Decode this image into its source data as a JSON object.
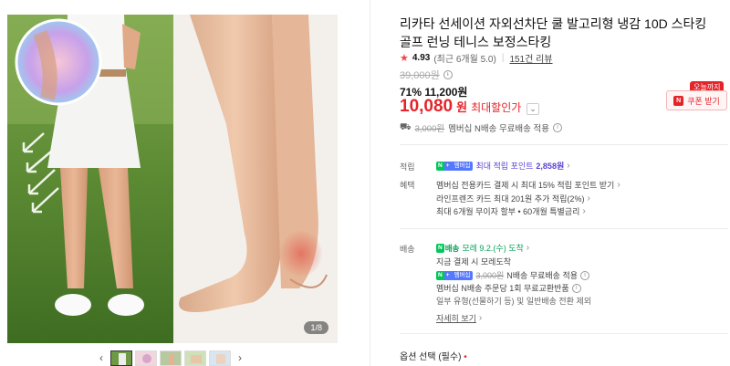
{
  "product": {
    "title": "리카타 선세이션 자외선차단 쿨 발고리형 냉감 10D 스타킹 골프 런닝 테니스 보정스타킹",
    "rating": "4.93",
    "rating_recent": "(최근 6개월 5.0)",
    "reviews": "151건 리뷰",
    "original_price": "39,000원",
    "discount_percent": "71%",
    "discount_price": "11,200원",
    "final_price": "10,080",
    "final_won": "원",
    "max_discount_label": "최대할인가",
    "image_counter": "1/8"
  },
  "coupon": {
    "badge": "오늘까지",
    "icon": "N",
    "label": "쿠폰 받기"
  },
  "shipping_summary": {
    "struck": "3,000원",
    "text": "멤버십 N배송 무료배송 적용"
  },
  "points": {
    "label": "적립",
    "npay_n": "N",
    "npay_plus": "+",
    "npay_member": "멤버십",
    "text_prefix": "최대 적립 포인트",
    "amount": "2,858원"
  },
  "benefits": {
    "label": "혜택",
    "lines": [
      "멤버십 전용카드 결제 시 최대 15% 적립 포인트 받기",
      "라인프렌즈 카드 최대 201원 추가 적립(2%)",
      "최대 6개월 무이자 할부 • 60개월 특별금리"
    ]
  },
  "delivery": {
    "label": "배송",
    "badge_n": "N",
    "badge_text": "배송",
    "eta": "모레 9.2.(수) 도착",
    "line2": "지금 결제 시 모레도착",
    "line3_struck": "3,000원",
    "line3_text": "N배송 무료배송 적용",
    "line4": "멤버십 N배송 주문당 1회 무료교환반품",
    "line5": "일부 유형(선물하기 등) 및 일반배송 전환 제외",
    "more": "자세히 보기"
  },
  "options": {
    "label": "옵션 선택 (필수)",
    "required_mark": "•"
  },
  "colors": {
    "accent_red": "#e5242a",
    "naver_green": "#03c75a",
    "point_purple": "#5a3fd8"
  }
}
